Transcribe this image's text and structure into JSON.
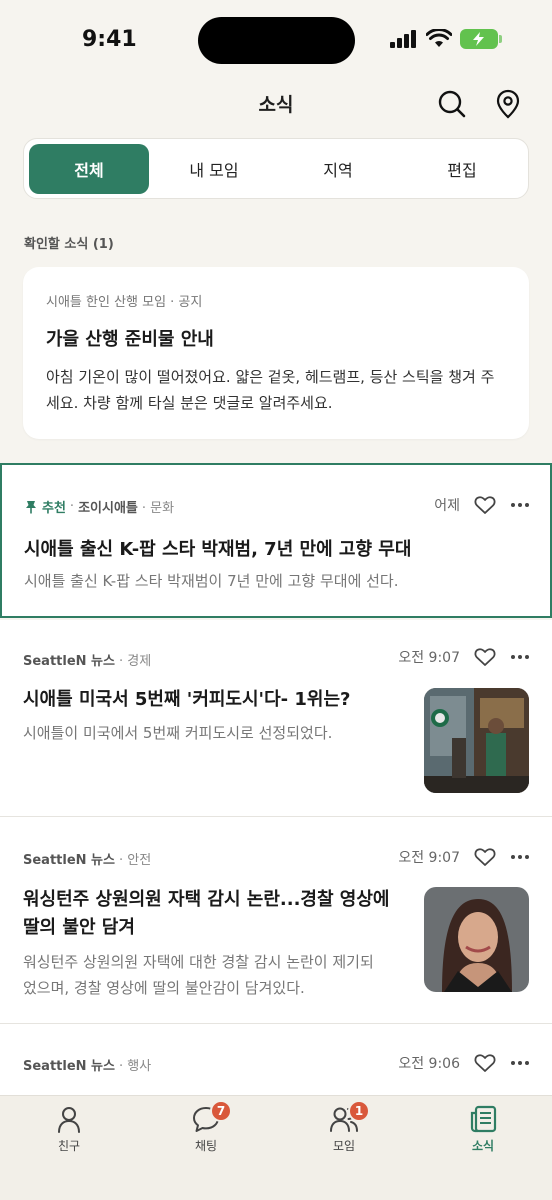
{
  "status_bar": {
    "time": "9:41"
  },
  "header": {
    "title": "소식"
  },
  "tabs": [
    "전체",
    "내 모임",
    "지역",
    "편집"
  ],
  "section_label": "확인할 소식 (1)",
  "notice": {
    "meta": "시애틀 한인 산행 모임 · 공지",
    "title": "가을 산행 준비물 안내",
    "body": "아침 기온이 많이 떨어졌어요. 얇은 겉옷, 헤드램프, 등산 스틱을 챙겨 주세요. 차량 함께 타실 분은 댓글로 알려주세요."
  },
  "news": [
    {
      "pin_label": "추천",
      "source": "조이시애틀",
      "category": "· 문화",
      "time": "어제",
      "title": "시애틀 출신 K-팝 스타 박재범, 7년 만에 고향 무대",
      "summary": "시애틀 출신 K-팝 스타 박재범이 7년 만에 고향 무대에 선다."
    },
    {
      "source": "SeattleN 뉴스",
      "category": "· 경제",
      "time": "오전 9:07",
      "title": "시애틀 미국서 5번째 '커피도시'다- 1위는?",
      "summary": "시애틀이 미국에서 5번째 커피도시로 선정되었다."
    },
    {
      "source": "SeattleN 뉴스",
      "category": "· 안전",
      "time": "오전 9:07",
      "title_line1": "워싱턴주 상원의원 자택 감시 논란...경찰 영상에",
      "title_line2": "딸의 불안 담겨",
      "summary_line1": "워싱턴주 상원의원 자택에 대한 경찰 감시 논란이 제기되",
      "summary_line2": "었으며, 경찰 영상에 딸의 불안감이 담겨있다."
    },
    {
      "source": "SeattleN 뉴스",
      "category": "· 행사",
      "time": "오전 9:06"
    }
  ],
  "tabbar": {
    "items": [
      {
        "label": "친구"
      },
      {
        "label": "채팅",
        "badge": "7"
      },
      {
        "label": "모임",
        "badge": "1"
      },
      {
        "label": "소식"
      }
    ]
  },
  "colors": {
    "accent": "#2f7d63",
    "badge": "#d9583b",
    "background": "#f6f4ef"
  }
}
